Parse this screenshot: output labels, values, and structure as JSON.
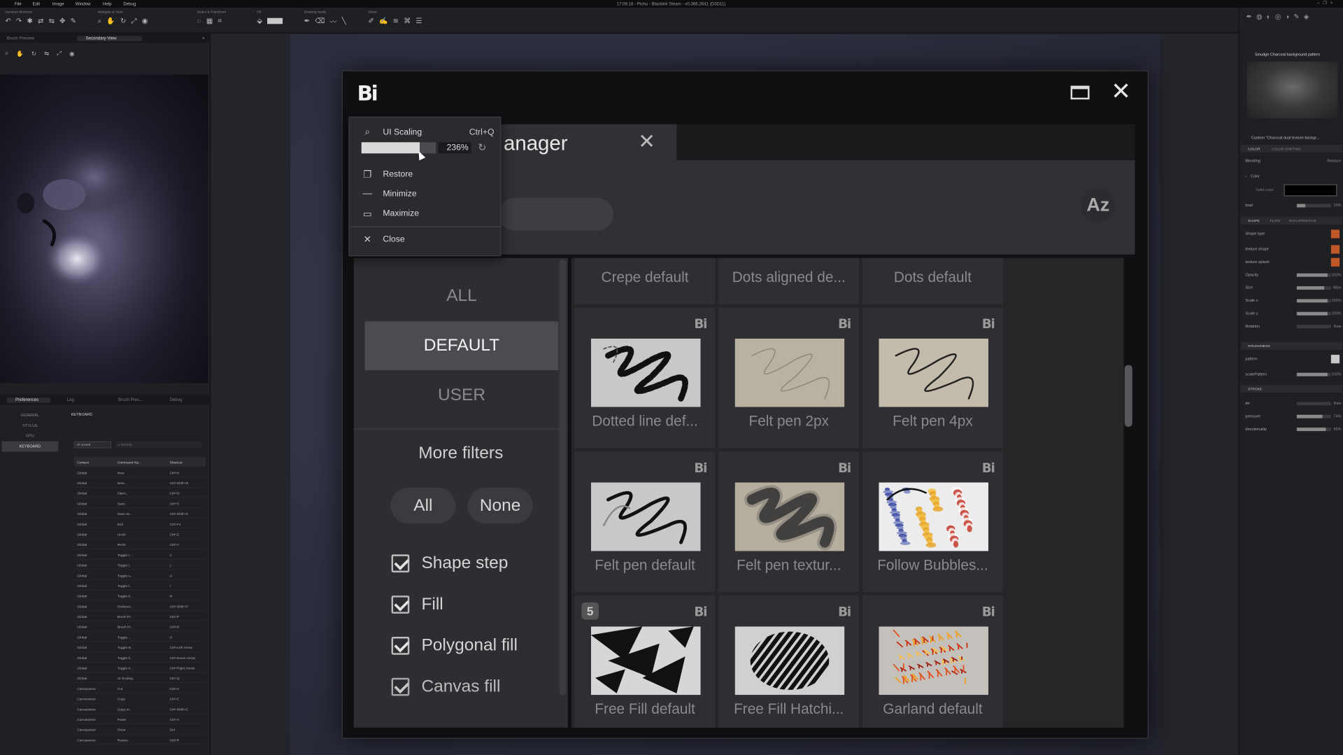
{
  "menubar": {
    "items": [
      "File",
      "Edit",
      "Image",
      "Window",
      "Help",
      "Debug"
    ],
    "title": "17:08:16 - Pichu - Blackink Steam - v0.366.2641 (D3D11)"
  },
  "toolbar": {
    "groups": [
      "General shortcuts",
      "Navigate & View",
      "Select & Transform",
      "Fill",
      "Drawing mode",
      "Show"
    ]
  },
  "left_panel": {
    "tabs": [
      "Brush Preview",
      "Secondary View"
    ],
    "prefs_tabs": [
      "Preferences",
      "Log",
      "Brush Pres...",
      "Debug"
    ],
    "pref_sections": [
      "GENERAL",
      "STYLUS",
      "GPU",
      "KEYBOARD"
    ],
    "active_section": "KEYBOARD",
    "keyboard_label": "KEYBOARD",
    "filter_value": "All sorted",
    "search_placeholder": "Search",
    "columns": [
      "Context",
      "Command Na...",
      "Shortcut"
    ],
    "rows": [
      [
        "Global",
        "New",
        "Ctrl+N"
      ],
      [
        "Global",
        "New..",
        "Ctrl+Shift+N"
      ],
      [
        "Global",
        "Open..",
        "Ctrl+O"
      ],
      [
        "Global",
        "Save",
        "Ctrl+S"
      ],
      [
        "Global",
        "Save as..",
        "Ctrl+Shift+S"
      ],
      [
        "Global",
        "Exit",
        "Ctrl+F4"
      ],
      [
        "Global",
        "Undo",
        "Ctrl+Z"
      ],
      [
        "Global",
        "Redo",
        "Ctrl+Y"
      ],
      [
        "Global",
        "Toggle l..",
        "C"
      ],
      [
        "Global",
        "Toggle l..",
        "L"
      ],
      [
        "Global",
        "Toggle s..",
        "U"
      ],
      [
        "Global",
        "Toggle l..",
        "I"
      ],
      [
        "Global",
        "Toggle b..",
        "M"
      ],
      [
        "Global",
        "Preferen..",
        "Ctrl+Shift+P"
      ],
      [
        "Global",
        "Brush Pr..",
        "Ctrl+P"
      ],
      [
        "Global",
        "Brush Pr..",
        "Ctrl+B"
      ],
      [
        "Global",
        "Toggle ..",
        "H"
      ],
      [
        "Global",
        "Toggle le..",
        "Ctrl+Left Arrow"
      ],
      [
        "Global",
        "Toggle b..",
        "Ctrl+Down Arrow"
      ],
      [
        "Global",
        "Toggle ri..",
        "Ctrl+Right Arrow"
      ],
      [
        "Global",
        "UI Scaling",
        "Ctrl+Q"
      ],
      [
        "Canvasview",
        "Cut",
        "Ctrl+X"
      ],
      [
        "Canvasview",
        "Copy",
        "Ctrl+C"
      ],
      [
        "Canvasview",
        "Copy m..",
        "Ctrl+Shift+C"
      ],
      [
        "Canvasview",
        "Paste",
        "Ctrl+V"
      ],
      [
        "Canvasview",
        "Clear",
        "Del"
      ],
      [
        "Canvasview",
        "Resize..",
        "Ctrl+R"
      ]
    ]
  },
  "right_panel": {
    "brush_name": "Smudge Charcoal background pattern",
    "custom_label": "Custom \"Charcoal dual texture backgr...",
    "tabs1": [
      "COLOR",
      "COLOR SHIFTING"
    ],
    "blending_label": "Blending",
    "blending_value": "Replace",
    "color_label": "Color",
    "solid_label": "Solid color",
    "load_label": "load",
    "load_value": "25%",
    "tabs2": [
      "SHAPE",
      "FLOW",
      "DUAL/PRIMITIVE"
    ],
    "shape_type_label": "Shape type",
    "rows2": [
      {
        "label": "texture shape",
        "kind": "swatch"
      },
      {
        "label": "texture splash",
        "kind": "swatch"
      },
      {
        "label": "Opacity",
        "value": "100%",
        "level": 0.9
      },
      {
        "label": "Size",
        "value": "48px",
        "level": 0.8
      },
      {
        "label": "Scale x",
        "value": "100%",
        "level": 0.9
      },
      {
        "label": "Scale y",
        "value": "100%",
        "level": 0.9
      },
      {
        "label": "Rotation",
        "value": "Raw",
        "level": 0.0
      }
    ],
    "roughness_label": "ROUGHNESS",
    "pattern_label": "pattern",
    "scale_pattern_label": "scalePattern",
    "scale_pattern_value": "100%",
    "stroke_label": "STROKE",
    "rows3": [
      {
        "label": "dir",
        "value": "Raw",
        "level": 0.0
      },
      {
        "label": "pressure",
        "value": "74%",
        "level": 0.74
      },
      {
        "label": "directionality",
        "value": "85%",
        "level": 0.85
      }
    ]
  },
  "dialog": {
    "logo": "Bi",
    "tab_title": "anager",
    "sort_label": "Az",
    "categories": [
      "ALL",
      "DEFAULT",
      "USER"
    ],
    "active_category": "DEFAULT",
    "more_filters": "More filters",
    "all_btn": "All",
    "none_btn": "None",
    "checks": [
      "Shape step",
      "Fill",
      "Polygonal fill",
      "Canvas fill"
    ],
    "brushes": [
      {
        "name": "Crepe default",
        "thumb": "none"
      },
      {
        "name": "Dots aligned de...",
        "thumb": "none"
      },
      {
        "name": "Dots default",
        "thumb": "none"
      },
      {
        "name": "Dotted line def...",
        "thumb": "dotted",
        "badge": "Bi"
      },
      {
        "name": "Felt pen 2px",
        "thumb": "felt2",
        "badge": "Bi"
      },
      {
        "name": "Felt pen 4px",
        "thumb": "felt4",
        "badge": "Bi"
      },
      {
        "name": "Felt pen default",
        "thumb": "feltdef",
        "badge": "Bi"
      },
      {
        "name": "Felt pen textur...",
        "thumb": "felttex",
        "badge": "Bi"
      },
      {
        "name": "Follow Bubbles...",
        "thumb": "bubbles",
        "badge": "Bi"
      },
      {
        "name": "Free Fill default",
        "thumb": "freefill",
        "badge": "Bi",
        "number": "5"
      },
      {
        "name": "Free Fill Hatchi...",
        "thumb": "hatch",
        "badge": "Bi"
      },
      {
        "name": "Garland default",
        "thumb": "garland",
        "badge": "Bi"
      }
    ]
  },
  "context_menu": {
    "ui_scaling": "UI Scaling",
    "ui_scaling_shortcut": "Ctrl+Q",
    "scale_value": "236%",
    "scale_level": 0.78,
    "items": [
      "Restore",
      "Minimize",
      "Maximize",
      "Close"
    ]
  }
}
